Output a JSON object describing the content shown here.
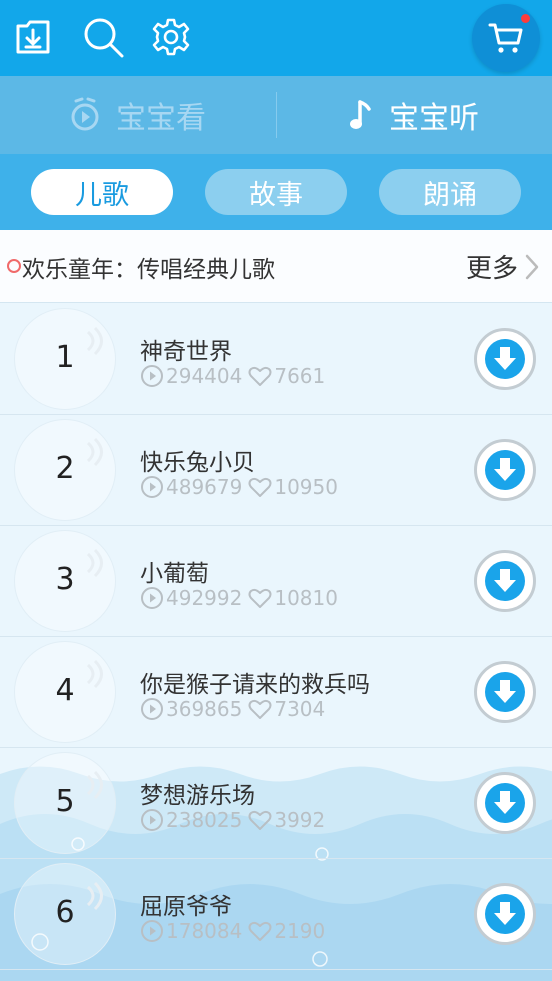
{
  "header": {
    "icons": [
      "download-box-icon",
      "search-icon",
      "settings-gear-icon",
      "cart-icon"
    ],
    "accent": "#12a7ea",
    "badge_color": "#ff3b3b"
  },
  "modes": [
    {
      "label": "宝宝看",
      "icon": "alarm-play-icon",
      "active": false
    },
    {
      "label": "宝宝听",
      "icon": "music-note-icon",
      "active": true
    }
  ],
  "tabs": [
    {
      "label": "儿歌",
      "active": true
    },
    {
      "label": "故事",
      "active": false
    },
    {
      "label": "朗诵",
      "active": false
    }
  ],
  "section": {
    "title": "欢乐童年：传唱经典儿歌",
    "more": "更多"
  },
  "songs": [
    {
      "rank": "1",
      "name": "神奇世界",
      "plays": "294404",
      "likes": "7661"
    },
    {
      "rank": "2",
      "name": "快乐兔小贝",
      "plays": "489679",
      "likes": "10950"
    },
    {
      "rank": "3",
      "name": "小葡萄",
      "plays": "492992",
      "likes": "10810"
    },
    {
      "rank": "4",
      "name": "你是猴子请来的救兵吗",
      "plays": "369865",
      "likes": "7304"
    },
    {
      "rank": "5",
      "name": "梦想游乐场",
      "plays": "238025",
      "likes": "3992"
    },
    {
      "rank": "6",
      "name": "屈原爷爷",
      "plays": "178084",
      "likes": "2190"
    }
  ]
}
